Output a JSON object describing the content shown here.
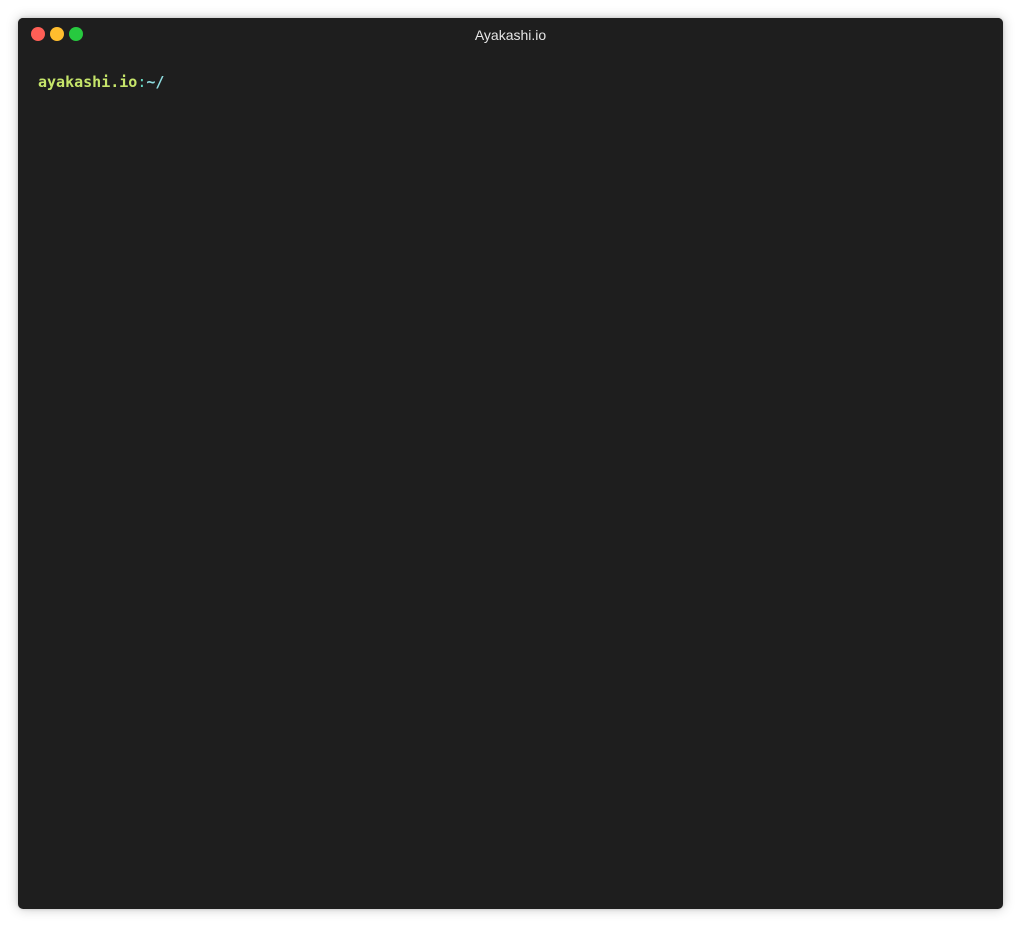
{
  "window": {
    "title": "Ayakashi.io",
    "controls": [
      "close",
      "minimize",
      "maximize"
    ]
  },
  "terminal": {
    "prompt": {
      "host": "ayakashi.io",
      "separator": ":",
      "path": "~/"
    }
  },
  "colors": {
    "background": "#1e1e1e",
    "title_text": "#e6e6e6",
    "host": "#c6e56a",
    "separator": "#66d9c4",
    "path": "#8fdde0",
    "close": "#ff5f56",
    "minimize": "#ffbd2e",
    "maximize": "#27c93f"
  }
}
